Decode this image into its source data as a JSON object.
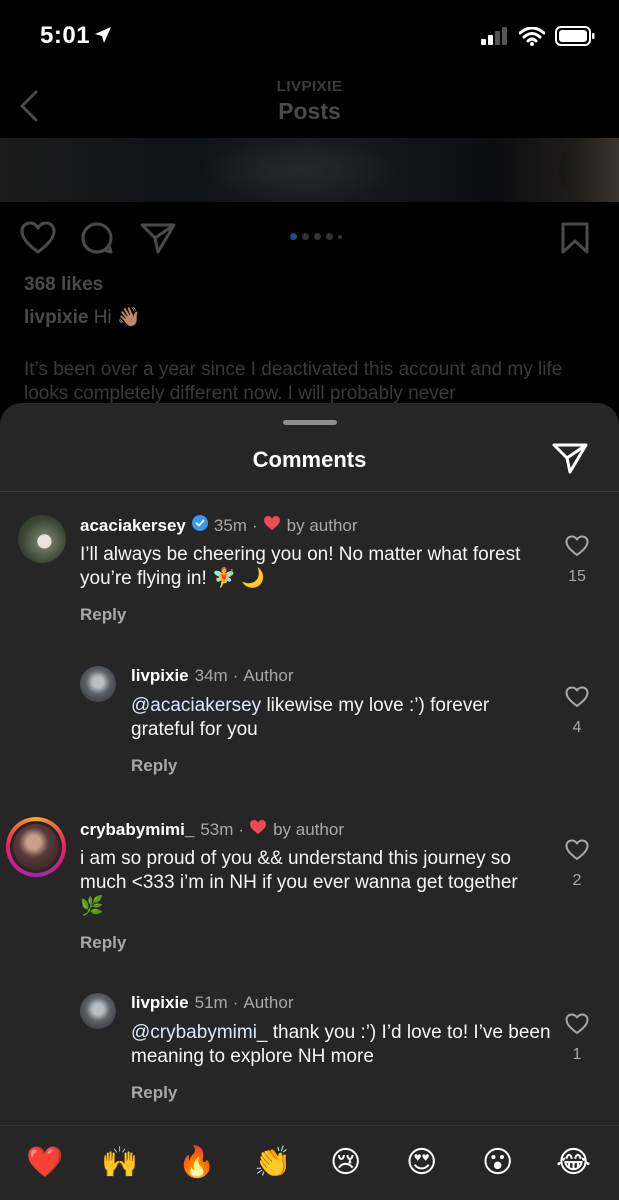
{
  "status": {
    "time": "5:01"
  },
  "nav": {
    "subtitle": "LIVPIXIE",
    "title": "Posts"
  },
  "post": {
    "likes": "368 likes",
    "caption_user": "livpixie",
    "caption_text": "Hi",
    "caption_body": "It’s been over a year since I deactivated this account and my life looks completely different now. I will probably never"
  },
  "sheet": {
    "title": "Comments"
  },
  "comments": [
    {
      "user": "acaciakersey",
      "time": "35m",
      "tag": "by author",
      "text": "I’ll always be cheering you on! No matter what forest you’re flying in! 🧚 🌙",
      "reply": "Reply",
      "likes": "15"
    },
    {
      "user": "livpixie",
      "time": "34m",
      "tag": "Author",
      "mention": "@acaciakersey",
      "text": " likewise my love :’) forever grateful for you",
      "reply": "Reply",
      "likes": "4"
    },
    {
      "user": "crybabymimi_",
      "time": "53m",
      "tag": "by author",
      "text": "i am so proud of you && understand this journey so much <333 i’m in NH if you ever wanna get together 🌿",
      "reply": "Reply",
      "likes": "2"
    },
    {
      "user": "livpixie",
      "time": "51m",
      "tag": "Author",
      "mention": "@crybabymimi_",
      "text": " thank you :’) I’d love to! I’ve been meaning to explore NH more",
      "reply": "Reply",
      "likes": "1"
    }
  ],
  "emoji_bar": [
    "❤️",
    "🙌",
    "🔥",
    "👏",
    "😢",
    "😍",
    "😮",
    "😂"
  ],
  "colors": {
    "sheet_bg": "#262626",
    "heart_red": "#ed4956",
    "verified_blue": "#3897f0"
  }
}
